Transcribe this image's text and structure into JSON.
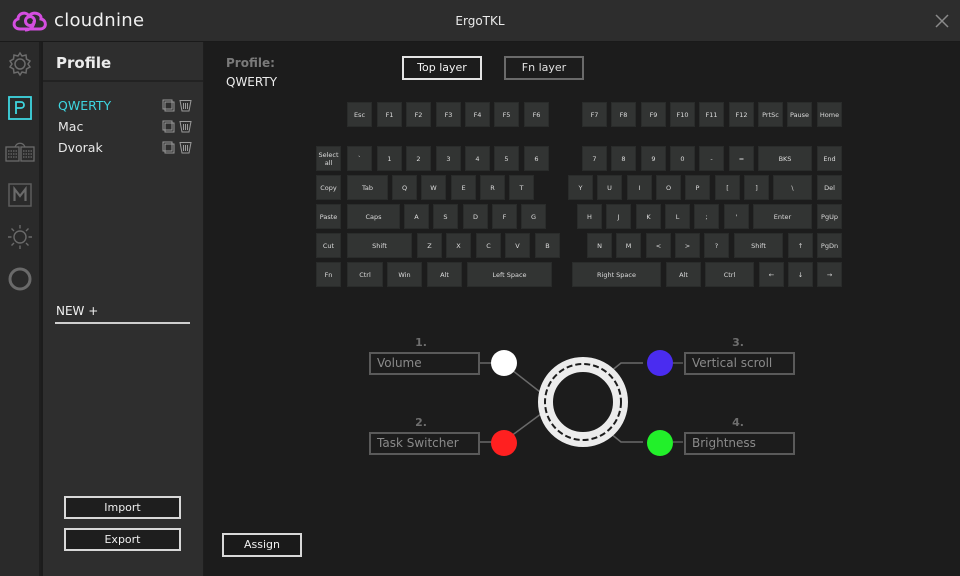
{
  "titlebar": {
    "brand": "cloudnine",
    "title": "ErgoTKL",
    "brand_color": "#d44ee0"
  },
  "nav_icons": [
    {
      "name": "settings",
      "icon": "gear-icon",
      "active": false
    },
    {
      "name": "profile",
      "icon": "profile-p-icon",
      "active": true
    },
    {
      "name": "keyboard",
      "icon": "split-keyboard-icon",
      "active": false
    },
    {
      "name": "macro",
      "icon": "macro-m-icon",
      "active": false
    },
    {
      "name": "lighting",
      "icon": "sun-icon",
      "active": false
    },
    {
      "name": "encoder",
      "icon": "ring-icon",
      "active": false
    }
  ],
  "profile_panel": {
    "header": "Profile",
    "profiles": [
      {
        "name": "QWERTY",
        "active": true
      },
      {
        "name": "Mac",
        "active": false
      },
      {
        "name": "Dvorak",
        "active": false
      }
    ],
    "new_label": "NEW +",
    "import_label": "Import",
    "export_label": "Export"
  },
  "main": {
    "profile_label": "Profile:",
    "profile_value": "QWERTY",
    "layers": {
      "top": "Top layer",
      "fn": "Fn layer",
      "active": "top"
    },
    "assign_label": "Assign",
    "accent_color": "#3ed6e0"
  },
  "keyboard": {
    "rows": [
      [
        [
          "Esc"
        ],
        [
          "F1"
        ],
        [
          "F2"
        ],
        [
          "F3"
        ],
        [
          "F4"
        ],
        [
          "F5"
        ],
        [
          "F6"
        ],
        [
          "F7"
        ],
        [
          "F8"
        ],
        [
          "F9"
        ],
        [
          "F10"
        ],
        [
          "F11"
        ],
        [
          "F12"
        ],
        [
          "PrtSc"
        ],
        [
          "Pause"
        ],
        [
          "Home"
        ]
      ],
      [
        [
          "Select all"
        ],
        [
          "`"
        ],
        [
          "1"
        ],
        [
          "2"
        ],
        [
          "3"
        ],
        [
          "4"
        ],
        [
          "5"
        ],
        [
          "6"
        ],
        [
          "7"
        ],
        [
          "8"
        ],
        [
          "9"
        ],
        [
          "0"
        ],
        [
          "-"
        ],
        [
          "="
        ],
        [
          "BKS"
        ],
        [
          "End"
        ]
      ],
      [
        [
          "Copy"
        ],
        [
          "Tab"
        ],
        [
          "Q"
        ],
        [
          "W"
        ],
        [
          "E"
        ],
        [
          "R"
        ],
        [
          "T"
        ],
        [
          "Y"
        ],
        [
          "U"
        ],
        [
          "I"
        ],
        [
          "O"
        ],
        [
          "P"
        ],
        [
          "["
        ],
        [
          "]"
        ],
        [
          "\\"
        ],
        [
          "Del"
        ]
      ],
      [
        [
          "Paste"
        ],
        [
          "Caps"
        ],
        [
          "A"
        ],
        [
          "S"
        ],
        [
          "D"
        ],
        [
          "F"
        ],
        [
          "G"
        ],
        [
          "H"
        ],
        [
          "J"
        ],
        [
          "K"
        ],
        [
          "L"
        ],
        [
          ";"
        ],
        [
          "'"
        ],
        [
          "Enter"
        ],
        [
          "PgUp"
        ]
      ],
      [
        [
          "Cut"
        ],
        [
          "Shift"
        ],
        [
          "Z"
        ],
        [
          "X"
        ],
        [
          "C"
        ],
        [
          "V"
        ],
        [
          "B"
        ],
        [
          "N"
        ],
        [
          "M"
        ],
        [
          "<"
        ],
        [
          ">"
        ],
        [
          "?"
        ],
        [
          "Shift"
        ],
        [
          "↑"
        ],
        [
          "PgDn"
        ]
      ],
      [
        [
          "Fn"
        ],
        [
          "Ctrl"
        ],
        [
          "Win"
        ],
        [
          "Alt"
        ],
        [
          "Left Space"
        ],
        [
          "Right Space"
        ],
        [
          "Alt"
        ],
        [
          "Ctrl"
        ],
        [
          "←"
        ],
        [
          "↓"
        ],
        [
          "→"
        ]
      ]
    ]
  },
  "encoder": {
    "actions": [
      {
        "number": "1.",
        "label": "Volume",
        "color": "#ffffff"
      },
      {
        "number": "2.",
        "label": "Task Switcher",
        "color": "#ff2020"
      },
      {
        "number": "3.",
        "label": "Vertical scroll",
        "color": "#4a2cf0"
      },
      {
        "number": "4.",
        "label": "Brightness",
        "color": "#22f02a"
      }
    ]
  }
}
